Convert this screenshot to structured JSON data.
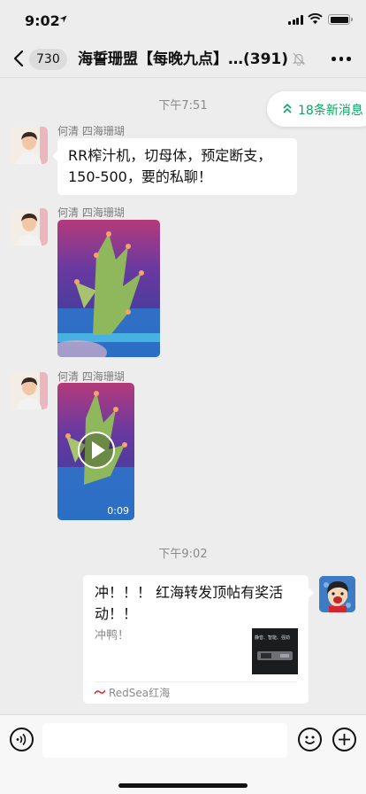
{
  "status_bar": {
    "time": "9:02"
  },
  "nav": {
    "unread_count": "730",
    "title": "海誓珊盟【每晚九点】…",
    "member_count": "(391)"
  },
  "new_messages": "18条新消息",
  "timestamps": [
    "下午7:51",
    "下午9:02"
  ],
  "messages": [
    {
      "type": "text",
      "sender": "何清 四海珊瑚",
      "text": "RR榨汁机，切母体，预定断支，150-500，要的私聊！"
    },
    {
      "type": "image",
      "sender": "何清 四海珊瑚"
    },
    {
      "type": "video",
      "sender": "何清 四海珊瑚",
      "duration": "0:09"
    },
    {
      "type": "link",
      "title": "冲！！！ 红海转发顶帖有奖活动！！",
      "desc": "冲鸭！",
      "thumb_text": "静音、智能、强劲",
      "source": "RedSea红海"
    }
  ]
}
